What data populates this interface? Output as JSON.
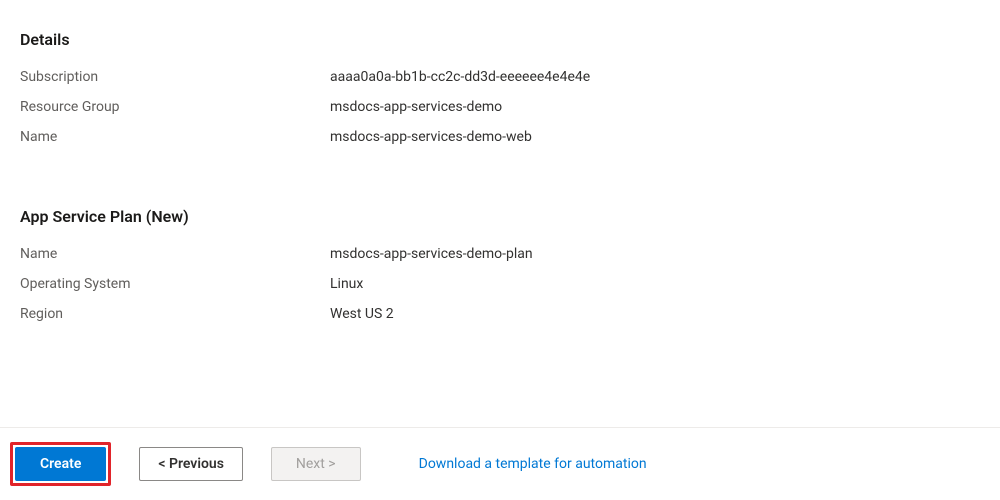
{
  "details": {
    "heading": "Details",
    "rows": [
      {
        "label": "Subscription",
        "value": "aaaa0a0a-bb1b-cc2c-dd3d-eeeeee4e4e4e"
      },
      {
        "label": "Resource Group",
        "value": "msdocs-app-services-demo"
      },
      {
        "label": "Name",
        "value": "msdocs-app-services-demo-web"
      }
    ]
  },
  "plan": {
    "heading": "App Service Plan (New)",
    "rows": [
      {
        "label": "Name",
        "value": "msdocs-app-services-demo-plan"
      },
      {
        "label": "Operating System",
        "value": "Linux"
      },
      {
        "label": "Region",
        "value": "West US 2"
      }
    ]
  },
  "footer": {
    "create_label": "Create",
    "previous_label": "< Previous",
    "next_label": "Next >",
    "download_link": "Download a template for automation"
  }
}
